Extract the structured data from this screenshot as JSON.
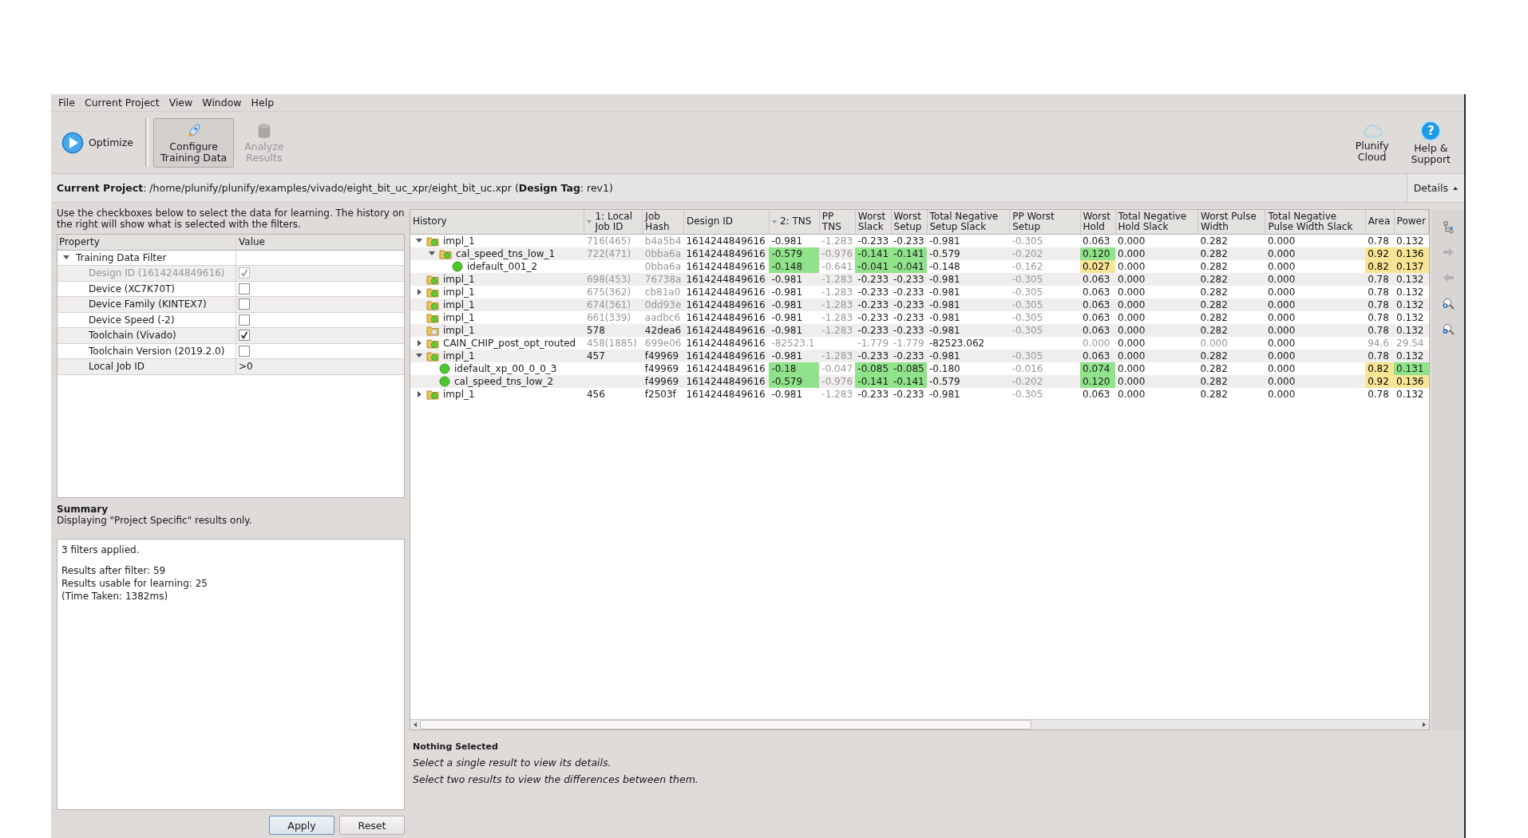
{
  "menu": [
    "File",
    "Current Project",
    "View",
    "Window",
    "Help"
  ],
  "toolbar": {
    "left": [
      {
        "kind": "play",
        "label": "Optimize",
        "selected": false,
        "disabled": false
      },
      {
        "kind": "rocket",
        "label": "Configure\nTraining Data",
        "selected": true,
        "disabled": false
      },
      {
        "kind": "database",
        "label": "Analyze\nResults",
        "selected": false,
        "disabled": true
      }
    ],
    "right": [
      {
        "kind": "cloud",
        "label": "Plunify\nCloud",
        "selected": false,
        "disabled": false
      },
      {
        "kind": "help",
        "glyph": "?",
        "label": "Help &\nSupport",
        "selected": false,
        "disabled": false
      }
    ]
  },
  "project_bar": {
    "text": "**Current Project**: /home/plunify/plunify/examples/vivado/eight_bit_uc_xpr/eight_bit_uc.xpr (**Design Tag**: rev1)",
    "details_button": "Details"
  },
  "filter_panel": {
    "instructions": "Use the checkboxes below to select the data for learning. The history on the right will show what is selected with the filters.",
    "columns": [
      "Property",
      "Value"
    ],
    "group": {
      "label": "Training Data Filter",
      "expanded": true,
      "items": [
        {
          "kind": "check",
          "label": "Design ID (1614244849616)",
          "checked": true,
          "disabled": true
        },
        {
          "kind": "check",
          "label": "Device (XC7K70T)",
          "checked": false,
          "disabled": false
        },
        {
          "kind": "check",
          "label": "Device Family (KINTEX7)",
          "checked": false,
          "disabled": false
        },
        {
          "kind": "check",
          "label": "Device Speed (-2)",
          "checked": false,
          "disabled": false
        },
        {
          "kind": "check",
          "label": "Toolchain (Vivado)",
          "checked": true,
          "disabled": false
        },
        {
          "kind": "check",
          "label": "Toolchain Version (2019.2.0)",
          "checked": false,
          "disabled": false
        },
        {
          "kind": "text",
          "label": "Local Job ID",
          "value": ">0",
          "disabled": false
        }
      ]
    }
  },
  "summary": {
    "title": "Summary",
    "subtitle": "Displaying \"Project Specific\" results only.",
    "paragraphs": [
      [
        "3 filters applied."
      ],
      [
        "Results after filter: 59",
        "Results usable for learning: 25",
        "(Time Taken: 1382ms)"
      ]
    ]
  },
  "buttons": [
    {
      "label": "Apply",
      "default": true
    },
    {
      "label": "Reset",
      "default": false
    }
  ],
  "history_table": {
    "columns": [
      {
        "label": "History",
        "sorted": false
      },
      {
        "label": "1: Local Job ID",
        "sorted": true
      },
      {
        "label": "Job Hash",
        "sorted": false
      },
      {
        "label": "Design ID",
        "sorted": false
      },
      {
        "label": "2: TNS",
        "sorted": true
      },
      {
        "label": "PP TNS",
        "sorted": false
      },
      {
        "label": "Worst Slack",
        "sorted": false
      },
      {
        "label": "Worst Setup",
        "sorted": false
      },
      {
        "label": "Total Negative Setup Slack",
        "sorted": false
      },
      {
        "label": "PP Worst Setup",
        "sorted": false
      },
      {
        "label": "Worst Hold",
        "sorted": false
      },
      {
        "label": "Total Negative Hold Slack",
        "sorted": false
      },
      {
        "label": "Worst Pulse Width",
        "sorted": false
      },
      {
        "label": "Total Negative Pulse Width Slack",
        "sorted": false
      },
      {
        "label": "Area",
        "sorted": false
      },
      {
        "label": "Power",
        "sorted": false
      }
    ],
    "rows": [
      {
        "kind": "folder",
        "done": true,
        "expanded": true,
        "cells": [
          {
            "text": "impl_1",
            "muted": false,
            "better": false,
            "worse": false
          },
          {
            "text": "716(465)",
            "muted": true,
            "better": false,
            "worse": false
          },
          {
            "text": "b4a5b4",
            "muted": true,
            "better": false,
            "worse": false
          },
          {
            "text": "1614244849616",
            "muted": false,
            "better": false,
            "worse": false
          },
          {
            "text": "-0.981",
            "muted": false,
            "better": false,
            "worse": false
          },
          {
            "text": "-1.283",
            "muted": true,
            "better": false,
            "worse": false
          },
          {
            "text": "-0.233",
            "muted": false,
            "better": false,
            "worse": false
          },
          {
            "text": "-0.233",
            "muted": false,
            "better": false,
            "worse": false
          },
          {
            "text": "-0.981",
            "muted": false,
            "better": false,
            "worse": false
          },
          {
            "text": "-0.305",
            "muted": true,
            "better": false,
            "worse": false
          },
          {
            "text": "0.063",
            "muted": false,
            "better": false,
            "worse": false
          },
          {
            "text": "0.000",
            "muted": false,
            "better": false,
            "worse": false
          },
          {
            "text": "0.282",
            "muted": false,
            "better": false,
            "worse": false
          },
          {
            "text": "0.000",
            "muted": false,
            "better": false,
            "worse": false
          },
          {
            "text": "0.78",
            "muted": false,
            "better": false,
            "worse": false
          },
          {
            "text": "0.132",
            "muted": false,
            "better": false,
            "worse": false
          }
        ],
        "children": [
          {
            "kind": "folder",
            "done": true,
            "expanded": true,
            "cells": [
              {
                "text": "cal_speed_tns_low_1",
                "muted": false,
                "better": false,
                "worse": false
              },
              {
                "text": "722(471)",
                "muted": true,
                "better": false,
                "worse": false
              },
              {
                "text": "0bba6a",
                "muted": true,
                "better": false,
                "worse": false
              },
              {
                "text": "1614244849616",
                "muted": false,
                "better": false,
                "worse": false
              },
              {
                "text": "-0.579",
                "muted": false,
                "better": true,
                "worse": false
              },
              {
                "text": "-0.976",
                "muted": true,
                "better": false,
                "worse": false
              },
              {
                "text": "-0.141",
                "muted": false,
                "better": true,
                "worse": false
              },
              {
                "text": "-0.141",
                "muted": false,
                "better": true,
                "worse": false
              },
              {
                "text": "-0.579",
                "muted": false,
                "better": false,
                "worse": false
              },
              {
                "text": "-0.202",
                "muted": true,
                "better": false,
                "worse": false
              },
              {
                "text": "0.120",
                "muted": false,
                "better": true,
                "worse": false
              },
              {
                "text": "0.000",
                "muted": false,
                "better": false,
                "worse": false
              },
              {
                "text": "0.282",
                "muted": false,
                "better": false,
                "worse": false
              },
              {
                "text": "0.000",
                "muted": false,
                "better": false,
                "worse": false
              },
              {
                "text": "0.92",
                "muted": false,
                "better": false,
                "worse": true
              },
              {
                "text": "0.136",
                "muted": false,
                "better": false,
                "worse": true
              }
            ],
            "children": [
              {
                "kind": "result",
                "cells": [
                  {
                    "text": "idefault_001_2",
                    "muted": false,
                    "better": false,
                    "worse": false
                  },
                  {
                    "text": ""
                  },
                  {
                    "text": "0bba6a",
                    "muted": true,
                    "better": false,
                    "worse": false
                  },
                  {
                    "text": "1614244849616",
                    "muted": false,
                    "better": false,
                    "worse": false
                  },
                  {
                    "text": "-0.148",
                    "muted": false,
                    "better": true,
                    "worse": false
                  },
                  {
                    "text": "-0.641",
                    "muted": true,
                    "better": false,
                    "worse": false
                  },
                  {
                    "text": "-0.041",
                    "muted": false,
                    "better": true,
                    "worse": false
                  },
                  {
                    "text": "-0.041",
                    "muted": false,
                    "better": true,
                    "worse": false
                  },
                  {
                    "text": "-0.148",
                    "muted": false,
                    "better": false,
                    "worse": false
                  },
                  {
                    "text": "-0.162",
                    "muted": true,
                    "better": false,
                    "worse": false
                  },
                  {
                    "text": "0.027",
                    "muted": false,
                    "better": false,
                    "worse": true
                  },
                  {
                    "text": "0.000",
                    "muted": false,
                    "better": false,
                    "worse": false
                  },
                  {
                    "text": "0.282",
                    "muted": false,
                    "better": false,
                    "worse": false
                  },
                  {
                    "text": "0.000",
                    "muted": false,
                    "better": false,
                    "worse": false
                  },
                  {
                    "text": "0.82",
                    "muted": false,
                    "better": false,
                    "worse": true
                  },
                  {
                    "text": "0.137",
                    "muted": false,
                    "better": false,
                    "worse": true
                  }
                ]
              }
            ]
          }
        ]
      },
      {
        "kind": "folder",
        "done": true,
        "cells": [
          {
            "text": "impl_1",
            "muted": false,
            "better": false,
            "worse": false
          },
          {
            "text": "698(453)",
            "muted": true,
            "better": false,
            "worse": false
          },
          {
            "text": "76738a",
            "muted": true,
            "better": false,
            "worse": false
          },
          {
            "text": "1614244849616",
            "muted": false,
            "better": false,
            "worse": false
          },
          {
            "text": "-0.981",
            "muted": false,
            "better": false,
            "worse": false
          },
          {
            "text": "-1.283",
            "muted": true,
            "better": false,
            "worse": false
          },
          {
            "text": "-0.233",
            "muted": false,
            "better": false,
            "worse": false
          },
          {
            "text": "-0.233",
            "muted": false,
            "better": false,
            "worse": false
          },
          {
            "text": "-0.981",
            "muted": false,
            "better": false,
            "worse": false
          },
          {
            "text": "-0.305",
            "muted": true,
            "better": false,
            "worse": false
          },
          {
            "text": "0.063",
            "muted": false,
            "better": false,
            "worse": false
          },
          {
            "text": "0.000",
            "muted": false,
            "better": false,
            "worse": false
          },
          {
            "text": "0.282",
            "muted": false,
            "better": false,
            "worse": false
          },
          {
            "text": "0.000",
            "muted": false,
            "better": false,
            "worse": false
          },
          {
            "text": "0.78",
            "muted": false,
            "better": false,
            "worse": false
          },
          {
            "text": "0.132",
            "muted": false,
            "better": false,
            "worse": false
          }
        ]
      },
      {
        "kind": "folder",
        "done": true,
        "expanded": false,
        "cells": [
          {
            "text": "impl_1",
            "muted": false,
            "better": false,
            "worse": false
          },
          {
            "text": "675(362)",
            "muted": true,
            "better": false,
            "worse": false
          },
          {
            "text": "cb81a0",
            "muted": true,
            "better": false,
            "worse": false
          },
          {
            "text": "1614244849616",
            "muted": false,
            "better": false,
            "worse": false
          },
          {
            "text": "-0.981",
            "muted": false,
            "better": false,
            "worse": false
          },
          {
            "text": "-1.283",
            "muted": true,
            "better": false,
            "worse": false
          },
          {
            "text": "-0.233",
            "muted": false,
            "better": false,
            "worse": false
          },
          {
            "text": "-0.233",
            "muted": false,
            "better": false,
            "worse": false
          },
          {
            "text": "-0.981",
            "muted": false,
            "better": false,
            "worse": false
          },
          {
            "text": "-0.305",
            "muted": true,
            "better": false,
            "worse": false
          },
          {
            "text": "0.063",
            "muted": false,
            "better": false,
            "worse": false
          },
          {
            "text": "0.000",
            "muted": false,
            "better": false,
            "worse": false
          },
          {
            "text": "0.282",
            "muted": false,
            "better": false,
            "worse": false
          },
          {
            "text": "0.000",
            "muted": false,
            "better": false,
            "worse": false
          },
          {
            "text": "0.78",
            "muted": false,
            "better": false,
            "worse": false
          },
          {
            "text": "0.132",
            "muted": false,
            "better": false,
            "worse": false
          }
        ]
      },
      {
        "kind": "folder",
        "done": true,
        "cells": [
          {
            "text": "impl_1",
            "muted": false,
            "better": false,
            "worse": false
          },
          {
            "text": "674(361)",
            "muted": true,
            "better": false,
            "worse": false
          },
          {
            "text": "0dd93e",
            "muted": true,
            "better": false,
            "worse": false
          },
          {
            "text": "1614244849616",
            "muted": false,
            "better": false,
            "worse": false
          },
          {
            "text": "-0.981",
            "muted": false,
            "better": false,
            "worse": false
          },
          {
            "text": "-1.283",
            "muted": true,
            "better": false,
            "worse": false
          },
          {
            "text": "-0.233",
            "muted": false,
            "better": false,
            "worse": false
          },
          {
            "text": "-0.233",
            "muted": false,
            "better": false,
            "worse": false
          },
          {
            "text": "-0.981",
            "muted": false,
            "better": false,
            "worse": false
          },
          {
            "text": "-0.305",
            "muted": true,
            "better": false,
            "worse": false
          },
          {
            "text": "0.063",
            "muted": false,
            "better": false,
            "worse": false
          },
          {
            "text": "0.000",
            "muted": false,
            "better": false,
            "worse": false
          },
          {
            "text": "0.282",
            "muted": false,
            "better": false,
            "worse": false
          },
          {
            "text": "0.000",
            "muted": false,
            "better": false,
            "worse": false
          },
          {
            "text": "0.78",
            "muted": false,
            "better": false,
            "worse": false
          },
          {
            "text": "0.132",
            "muted": false,
            "better": false,
            "worse": false
          }
        ]
      },
      {
        "kind": "folder",
        "done": true,
        "cells": [
          {
            "text": "impl_1",
            "muted": false,
            "better": false,
            "worse": false
          },
          {
            "text": "661(339)",
            "muted": true,
            "better": false,
            "worse": false
          },
          {
            "text": "aadbc6",
            "muted": true,
            "better": false,
            "worse": false
          },
          {
            "text": "1614244849616",
            "muted": false,
            "better": false,
            "worse": false
          },
          {
            "text": "-0.981",
            "muted": false,
            "better": false,
            "worse": false
          },
          {
            "text": "-1.283",
            "muted": true,
            "better": false,
            "worse": false
          },
          {
            "text": "-0.233",
            "muted": false,
            "better": false,
            "worse": false
          },
          {
            "text": "-0.233",
            "muted": false,
            "better": false,
            "worse": false
          },
          {
            "text": "-0.981",
            "muted": false,
            "better": false,
            "worse": false
          },
          {
            "text": "-0.305",
            "muted": true,
            "better": false,
            "worse": false
          },
          {
            "text": "0.063",
            "muted": false,
            "better": false,
            "worse": false
          },
          {
            "text": "0.000",
            "muted": false,
            "better": false,
            "worse": false
          },
          {
            "text": "0.282",
            "muted": false,
            "better": false,
            "worse": false
          },
          {
            "text": "0.000",
            "muted": false,
            "better": false,
            "worse": false
          },
          {
            "text": "0.78",
            "muted": false,
            "better": false,
            "worse": false
          },
          {
            "text": "0.132",
            "muted": false,
            "better": false,
            "worse": false
          }
        ]
      },
      {
        "kind": "folder",
        "done": false,
        "cells": [
          {
            "text": "impl_1",
            "muted": false,
            "better": false,
            "worse": false
          },
          {
            "text": "578",
            "muted": false,
            "better": false,
            "worse": false
          },
          {
            "text": "42dea6",
            "muted": false,
            "better": false,
            "worse": false
          },
          {
            "text": "1614244849616",
            "muted": false,
            "better": false,
            "worse": false
          },
          {
            "text": "-0.981",
            "muted": false,
            "better": false,
            "worse": false
          },
          {
            "text": "-1.283",
            "muted": true,
            "better": false,
            "worse": false
          },
          {
            "text": "-0.233",
            "muted": false,
            "better": false,
            "worse": false
          },
          {
            "text": "-0.233",
            "muted": false,
            "better": false,
            "worse": false
          },
          {
            "text": "-0.981",
            "muted": false,
            "better": false,
            "worse": false
          },
          {
            "text": "-0.305",
            "muted": true,
            "better": false,
            "worse": false
          },
          {
            "text": "0.063",
            "muted": false,
            "better": false,
            "worse": false
          },
          {
            "text": "0.000",
            "muted": false,
            "better": false,
            "worse": false
          },
          {
            "text": "0.282",
            "muted": false,
            "better": false,
            "worse": false
          },
          {
            "text": "0.000",
            "muted": false,
            "better": false,
            "worse": false
          },
          {
            "text": "0.78",
            "muted": false,
            "better": false,
            "worse": false
          },
          {
            "text": "0.132",
            "muted": false,
            "better": false,
            "worse": false
          }
        ]
      },
      {
        "kind": "folder",
        "done": true,
        "expanded": false,
        "cells": [
          {
            "text": "CAIN_CHIP_post_opt_routed",
            "muted": false,
            "better": false,
            "worse": false
          },
          {
            "text": "458(1885)",
            "muted": true,
            "better": false,
            "worse": false
          },
          {
            "text": "699e06",
            "muted": true,
            "better": false,
            "worse": false
          },
          {
            "text": "1614244849616",
            "muted": false,
            "better": false,
            "worse": false
          },
          {
            "text": "-82523.1",
            "muted": true,
            "better": false,
            "worse": false
          },
          {
            "text": ""
          },
          {
            "text": "-1.779",
            "muted": true,
            "better": false,
            "worse": false
          },
          {
            "text": "-1.779",
            "muted": true,
            "better": false,
            "worse": false
          },
          {
            "text": "-82523.062",
            "muted": false,
            "better": false,
            "worse": false
          },
          {
            "text": ""
          },
          {
            "text": "0.000",
            "muted": true,
            "better": false,
            "worse": false
          },
          {
            "text": "0.000",
            "muted": false,
            "better": false,
            "worse": false
          },
          {
            "text": "0.000",
            "muted": true,
            "better": false,
            "worse": false
          },
          {
            "text": "0.000",
            "muted": false,
            "better": false,
            "worse": false
          },
          {
            "text": "94.6",
            "muted": true,
            "better": false,
            "worse": false
          },
          {
            "text": "29.54",
            "muted": true,
            "better": false,
            "worse": false
          }
        ]
      },
      {
        "kind": "folder",
        "done": true,
        "expanded": true,
        "cells": [
          {
            "text": "impl_1",
            "muted": false,
            "better": false,
            "worse": false
          },
          {
            "text": "457",
            "muted": false,
            "better": false,
            "worse": false
          },
          {
            "text": "f49969",
            "muted": false,
            "better": false,
            "worse": false
          },
          {
            "text": "1614244849616",
            "muted": false,
            "better": false,
            "worse": false
          },
          {
            "text": "-0.981",
            "muted": false,
            "better": false,
            "worse": false
          },
          {
            "text": "-1.283",
            "muted": true,
            "better": false,
            "worse": false
          },
          {
            "text": "-0.233",
            "muted": false,
            "better": false,
            "worse": false
          },
          {
            "text": "-0.233",
            "muted": false,
            "better": false,
            "worse": false
          },
          {
            "text": "-0.981",
            "muted": false,
            "better": false,
            "worse": false
          },
          {
            "text": "-0.305",
            "muted": true,
            "better": false,
            "worse": false
          },
          {
            "text": "0.063",
            "muted": false,
            "better": false,
            "worse": false
          },
          {
            "text": "0.000",
            "muted": false,
            "better": false,
            "worse": false
          },
          {
            "text": "0.282",
            "muted": false,
            "better": false,
            "worse": false
          },
          {
            "text": "0.000",
            "muted": false,
            "better": false,
            "worse": false
          },
          {
            "text": "0.78",
            "muted": false,
            "better": false,
            "worse": false
          },
          {
            "text": "0.132",
            "muted": false,
            "better": false,
            "worse": false
          }
        ],
        "children": [
          {
            "kind": "result",
            "cells": [
              {
                "text": "idefault_xp_00_0_0_3",
                "muted": false,
                "better": false,
                "worse": false
              },
              {
                "text": ""
              },
              {
                "text": "f49969",
                "muted": false,
                "better": false,
                "worse": false
              },
              {
                "text": "1614244849616",
                "muted": false,
                "better": false,
                "worse": false
              },
              {
                "text": "-0.18",
                "muted": false,
                "better": true,
                "worse": false
              },
              {
                "text": "-0.047",
                "muted": true,
                "better": false,
                "worse": false
              },
              {
                "text": "-0.085",
                "muted": false,
                "better": true,
                "worse": false
              },
              {
                "text": "-0.085",
                "muted": false,
                "better": true,
                "worse": false
              },
              {
                "text": "-0.180",
                "muted": false,
                "better": false,
                "worse": false
              },
              {
                "text": "-0.016",
                "muted": true,
                "better": false,
                "worse": false
              },
              {
                "text": "0.074",
                "muted": false,
                "better": true,
                "worse": false
              },
              {
                "text": "0.000",
                "muted": false,
                "better": false,
                "worse": false
              },
              {
                "text": "0.282",
                "muted": false,
                "better": false,
                "worse": false
              },
              {
                "text": "0.000",
                "muted": false,
                "better": false,
                "worse": false
              },
              {
                "text": "0.82",
                "muted": false,
                "better": false,
                "worse": true
              },
              {
                "text": "0.131",
                "muted": false,
                "better": true,
                "worse": false
              }
            ]
          },
          {
            "kind": "result",
            "cells": [
              {
                "text": "cal_speed_tns_low_2",
                "muted": false,
                "better": false,
                "worse": false
              },
              {
                "text": ""
              },
              {
                "text": "f49969",
                "muted": false,
                "better": false,
                "worse": false
              },
              {
                "text": "1614244849616",
                "muted": false,
                "better": false,
                "worse": false
              },
              {
                "text": "-0.579",
                "muted": false,
                "better": true,
                "worse": false
              },
              {
                "text": "-0.976",
                "muted": true,
                "better": false,
                "worse": false
              },
              {
                "text": "-0.141",
                "muted": false,
                "better": true,
                "worse": false
              },
              {
                "text": "-0.141",
                "muted": false,
                "better": true,
                "worse": false
              },
              {
                "text": "-0.579",
                "muted": false,
                "better": false,
                "worse": false
              },
              {
                "text": "-0.202",
                "muted": true,
                "better": false,
                "worse": false
              },
              {
                "text": "0.120",
                "muted": false,
                "better": true,
                "worse": false
              },
              {
                "text": "0.000",
                "muted": false,
                "better": false,
                "worse": false
              },
              {
                "text": "0.282",
                "muted": false,
                "better": false,
                "worse": false
              },
              {
                "text": "0.000",
                "muted": false,
                "better": false,
                "worse": false
              },
              {
                "text": "0.92",
                "muted": false,
                "better": false,
                "worse": true
              },
              {
                "text": "0.136",
                "muted": false,
                "better": false,
                "worse": true
              }
            ]
          }
        ]
      },
      {
        "kind": "folder",
        "done": true,
        "expanded": false,
        "cells": [
          {
            "text": "impl_1",
            "muted": false,
            "better": false,
            "worse": false
          },
          {
            "text": "456",
            "muted": false,
            "better": false,
            "worse": false
          },
          {
            "text": "f2503f",
            "muted": false,
            "better": false,
            "worse": false
          },
          {
            "text": "1614244849616",
            "muted": false,
            "better": false,
            "worse": false
          },
          {
            "text": "-0.981",
            "muted": false,
            "better": false,
            "worse": false
          },
          {
            "text": "-1.283",
            "muted": true,
            "better": false,
            "worse": false
          },
          {
            "text": "-0.233",
            "muted": false,
            "better": false,
            "worse": false
          },
          {
            "text": "-0.233",
            "muted": false,
            "better": false,
            "worse": false
          },
          {
            "text": "-0.981",
            "muted": false,
            "better": false,
            "worse": false
          },
          {
            "text": "-0.305",
            "muted": true,
            "better": false,
            "worse": false
          },
          {
            "text": "0.063",
            "muted": false,
            "better": false,
            "worse": false
          },
          {
            "text": "0.000",
            "muted": false,
            "better": false,
            "worse": false
          },
          {
            "text": "0.282",
            "muted": false,
            "better": false,
            "worse": false
          },
          {
            "text": "0.000",
            "muted": false,
            "better": false,
            "worse": false
          },
          {
            "text": "0.78",
            "muted": false,
            "better": false,
            "worse": false
          },
          {
            "text": "0.132",
            "muted": false,
            "better": false,
            "worse": false
          }
        ]
      }
    ]
  },
  "side_tools": [
    {
      "kind": "tree",
      "disabled": false
    },
    {
      "kind": "forward",
      "disabled": true
    },
    {
      "kind": "back",
      "disabled": true
    },
    {
      "kind": "zoom-in",
      "disabled": false
    },
    {
      "kind": "zoom-out",
      "disabled": false
    }
  ],
  "details": {
    "title": "Nothing Selected",
    "lines": [
      "Select a single result to view its details.",
      "Select two results to view the differences between them."
    ]
  }
}
